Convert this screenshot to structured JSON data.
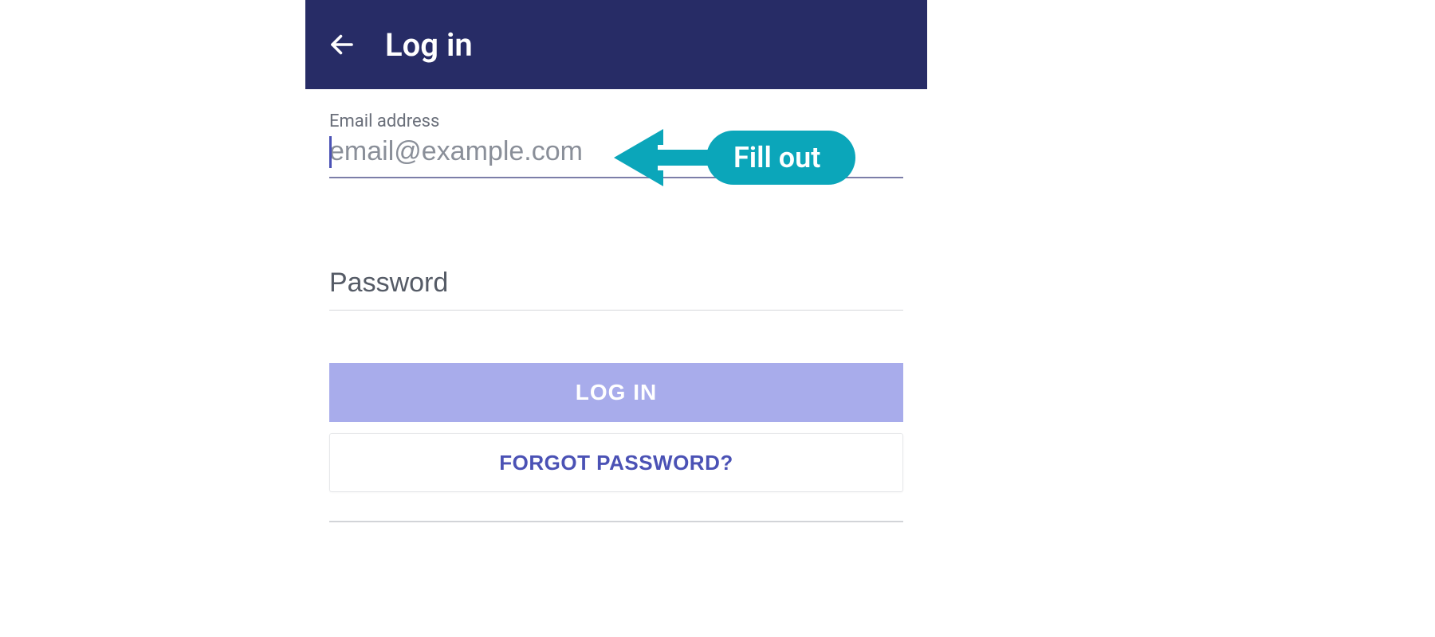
{
  "header": {
    "title": "Log in"
  },
  "form": {
    "email": {
      "label": "Email address",
      "placeholder": "email@example.com",
      "value": ""
    },
    "password": {
      "placeholder": "Password",
      "value": ""
    }
  },
  "buttons": {
    "login": "LOG IN",
    "forgot": "FORGOT PASSWORD?"
  },
  "annotation": {
    "callout": "Fill out"
  },
  "colors": {
    "header_bg": "#272c66",
    "accent": "#4b52b5",
    "button_bg": "#a8aceb",
    "callout": "#0ba6ba"
  }
}
